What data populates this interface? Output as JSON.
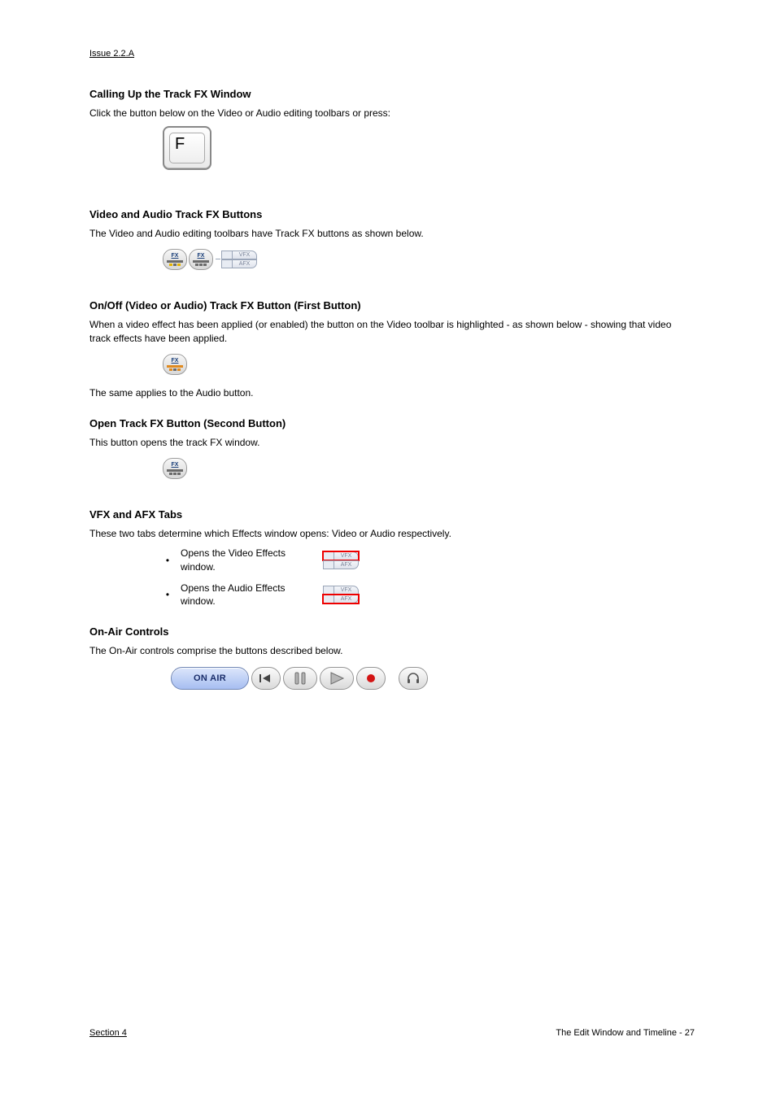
{
  "header": "Issue 2.2.A",
  "s1": {
    "title": "Calling Up the Track FX Window",
    "p1": "Click the button below on the Video or Audio editing toolbars or press:"
  },
  "key": {
    "letter": "F"
  },
  "s2": {
    "title": "Video and Audio Track FX Buttons",
    "p1": "The Video and Audio editing toolbars have Track FX buttons as shown below.",
    "img_desc": "Toolbar showing two FX pill buttons and VFX/AFX tabs"
  },
  "fx_label": "FX",
  "tabs": {
    "vfx": "VFX",
    "afx": "AFX"
  },
  "s3": {
    "title": "On/Off (Video or Audio) Track FX Button (First Button)",
    "p1": "When a video effect has been applied (or enabled) the button on the Video toolbar is highlighted - as shown below - showing that video track effects have been applied.",
    "p2": "The same applies to the Audio button."
  },
  "s4": {
    "title": "Open Track FX Button (Second Button)",
    "p1": "This button opens the track FX window."
  },
  "s5": {
    "title": "VFX and AFX Tabs",
    "p1": "These two tabs determine which Effects window opens: Video or Audio respectively.",
    "bullets": {
      "b1": "Opens the Video Effects window.",
      "b2": "Opens the Audio Effects window."
    }
  },
  "s6": {
    "title": "On-Air Controls",
    "p1": "The On-Air controls comprise the buttons described below."
  },
  "footer": {
    "left": "Section 4",
    "right": "The Edit Window and Timeline - 27"
  }
}
